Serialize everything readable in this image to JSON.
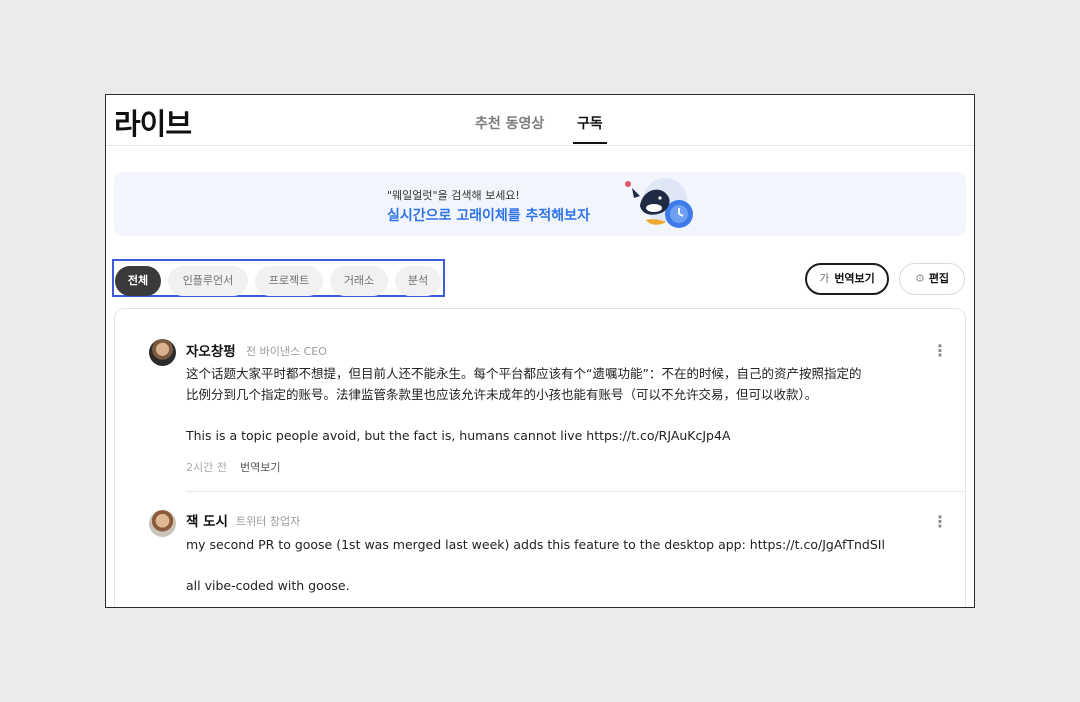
{
  "header": {
    "title": "라이브",
    "tabs": [
      {
        "label": "추천 동영상",
        "active": false
      },
      {
        "label": "구독",
        "active": true
      }
    ]
  },
  "banner": {
    "subtitle": "\"웨일얼럿\"을 검색해 보세요!",
    "headline": "실시간으로 고래이체를 추적해보자",
    "illustration_icon": "whale-clock-illustration"
  },
  "filters": {
    "chips": [
      "전체",
      "인플루언서",
      "프로젝트",
      "거래소",
      "분석"
    ],
    "active_index": 0
  },
  "actions": {
    "translate_glyph": "가",
    "translate_label": "번역보기",
    "edit_label": "편집",
    "edit_icon": "gear-icon"
  },
  "posts": [
    {
      "author": "자오창펑",
      "role": "전 바이낸스 CEO",
      "lines": [
        "这个话题大家平时都不想提，但目前人还不能永生。每个平台都应该有个“遗嘱功能”：不在的时候，自己的资产按照指定的",
        "比例分到几个指定的账号。法律监管条款里也应该允许未成年的小孩也能有账号（可以不允许交易，但可以收款）。",
        "This is a topic people avoid, but the fact is, humans cannot live https://t.co/RJAuKcJp4A"
      ],
      "time": "2시간 전",
      "translate_link": "번역보기",
      "more_glyph": "⋮"
    },
    {
      "author": "잭 도시",
      "role": "트위터 창업자",
      "lines": [
        "my second PR to goose (1st was merged last week) adds this feature to the desktop app: https://t.co/JgAfTndSIl",
        "all vibe-coded with goose."
      ],
      "more_glyph": "⋮"
    }
  ],
  "colors": {
    "accent_blue": "#2f74e6",
    "selection_border": "#3b5bdb",
    "active_chip": "#3a3a3c",
    "banner_bg": "#f2f5fb"
  }
}
